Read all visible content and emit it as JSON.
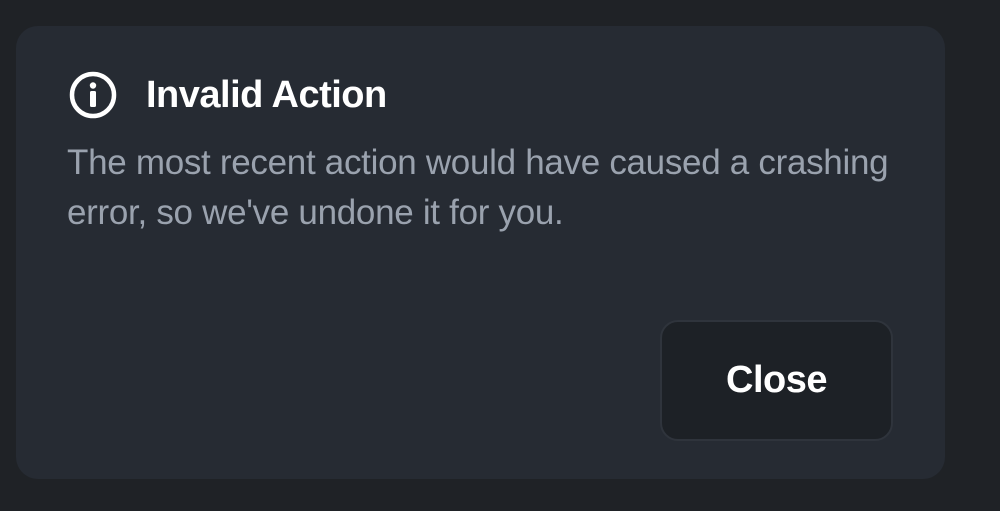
{
  "dialog": {
    "title": "Invalid Action",
    "icon": "info-icon",
    "message": "The most recent action would have caused a crashing error, so we've undone it for you.",
    "close_label": "Close"
  },
  "colors": {
    "background": "#1f2226",
    "dialog_bg": "#262b33",
    "title": "#ffffff",
    "message": "#9aa2ae",
    "button_bg": "#1d2126"
  }
}
